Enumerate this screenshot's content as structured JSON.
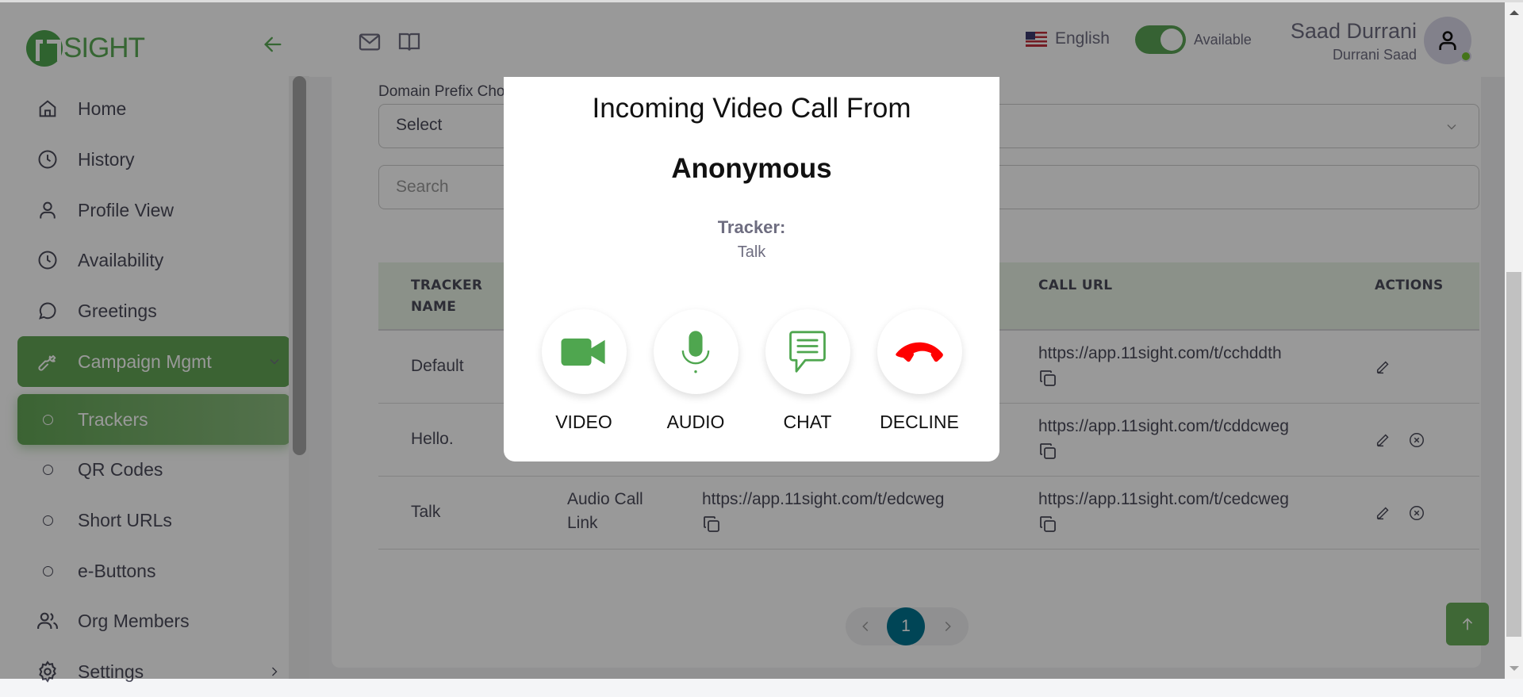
{
  "app": {
    "logo_text": "SIGHT",
    "brand_color": "#5aaa55"
  },
  "sidebar": {
    "items": [
      {
        "label": "Home",
        "icon": "home-icon"
      },
      {
        "label": "History",
        "icon": "clock-icon"
      },
      {
        "label": "Profile View",
        "icon": "user-icon"
      },
      {
        "label": "Availability",
        "icon": "clock-icon"
      },
      {
        "label": "Greetings",
        "icon": "chat-bubble-icon"
      },
      {
        "label": "Campaign Mgmt",
        "icon": "wrench-icon",
        "expanded": true
      },
      {
        "label": "Trackers",
        "icon": "circle-icon",
        "active": true
      },
      {
        "label": "QR Codes",
        "icon": "circle-icon"
      },
      {
        "label": "Short URLs",
        "icon": "circle-icon"
      },
      {
        "label": "e-Buttons",
        "icon": "circle-icon"
      },
      {
        "label": "Org Members",
        "icon": "users-icon"
      },
      {
        "label": "Settings",
        "icon": "gear-icon"
      }
    ]
  },
  "header": {
    "language": "English",
    "availability_label": "Available",
    "availability_on": true,
    "user_name": "Saad Durrani",
    "user_subname": "Durrani Saad",
    "status": "online"
  },
  "filters": {
    "domain_label": "Domain Prefix Choice",
    "domain_value": "Select",
    "search_placeholder": "Search"
  },
  "table": {
    "headers": [
      "TRACKER NAME",
      "CALL URL",
      "ACTIONS"
    ],
    "rows": [
      {
        "name": "Default",
        "type": "",
        "short_url": "",
        "call_url": "https://app.11sight.com/t/cchddth",
        "can_delete": false
      },
      {
        "name": "Hello.",
        "type": "",
        "short_url": "",
        "call_url": "https://app.11sight.com/t/cddcweg",
        "can_delete": true
      },
      {
        "name": "Talk",
        "type": "Audio Call Link",
        "short_url": "https://app.11sight.com/t/edcweg",
        "call_url": "https://app.11sight.com/t/cedcweg",
        "can_delete": true
      }
    ]
  },
  "pagination": {
    "current_page": "1"
  },
  "modal": {
    "title": "Incoming Video Call From",
    "caller": "Anonymous",
    "tracker_label": "Tracker:",
    "tracker_value": "Talk",
    "buttons": [
      {
        "label": "VIDEO",
        "icon": "video-camera-icon",
        "color": "#4fa64f"
      },
      {
        "label": "AUDIO",
        "icon": "microphone-icon",
        "color": "#4fa64f"
      },
      {
        "label": "CHAT",
        "icon": "chat-icon",
        "color": "#4fa64f"
      },
      {
        "label": "DECLINE",
        "icon": "hang-up-icon",
        "color": "#ff0000"
      }
    ]
  }
}
